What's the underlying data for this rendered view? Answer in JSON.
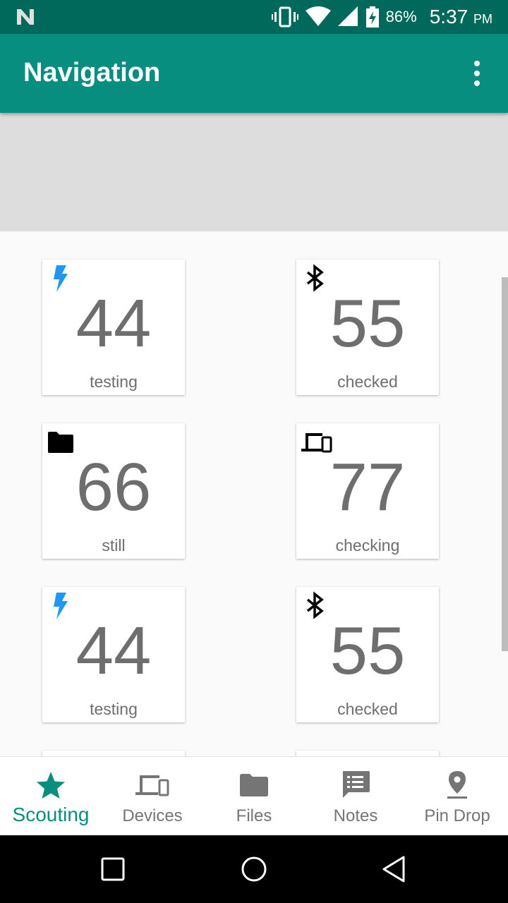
{
  "status_bar": {
    "battery_percent": "86%",
    "time": "5:37",
    "ampm": "PM",
    "icons": [
      "n-logo-icon",
      "vibrate-icon",
      "wifi-icon",
      "cell-signal-icon",
      "battery-charging-icon"
    ]
  },
  "app_bar": {
    "title": "Navigation",
    "overflow_icon": "more-vert-icon"
  },
  "colors": {
    "primary": "#078e7e",
    "primary_dark": "#00695c",
    "accent_blue": "#2196f3",
    "number_grey": "#6e6e6e"
  },
  "cards": [
    {
      "icon": "flash-icon",
      "value": "44",
      "label": "testing"
    },
    {
      "icon": "bluetooth-icon",
      "value": "55",
      "label": "checked"
    },
    {
      "icon": "folder-icon",
      "value": "66",
      "label": "still"
    },
    {
      "icon": "devices-icon",
      "value": "77",
      "label": "checking"
    },
    {
      "icon": "flash-icon",
      "value": "44",
      "label": "testing"
    },
    {
      "icon": "bluetooth-icon",
      "value": "55",
      "label": "checked"
    }
  ],
  "bottom_nav": {
    "active": "Scouting",
    "items": [
      {
        "label": "Scouting",
        "icon": "star-icon"
      },
      {
        "label": "Devices",
        "icon": "devices-icon"
      },
      {
        "label": "Files",
        "icon": "folder-icon"
      },
      {
        "label": "Notes",
        "icon": "notes-icon"
      },
      {
        "label": "Pin Drop",
        "icon": "pin-drop-icon"
      }
    ]
  },
  "system_nav": [
    "recents-icon",
    "home-icon",
    "back-icon"
  ]
}
